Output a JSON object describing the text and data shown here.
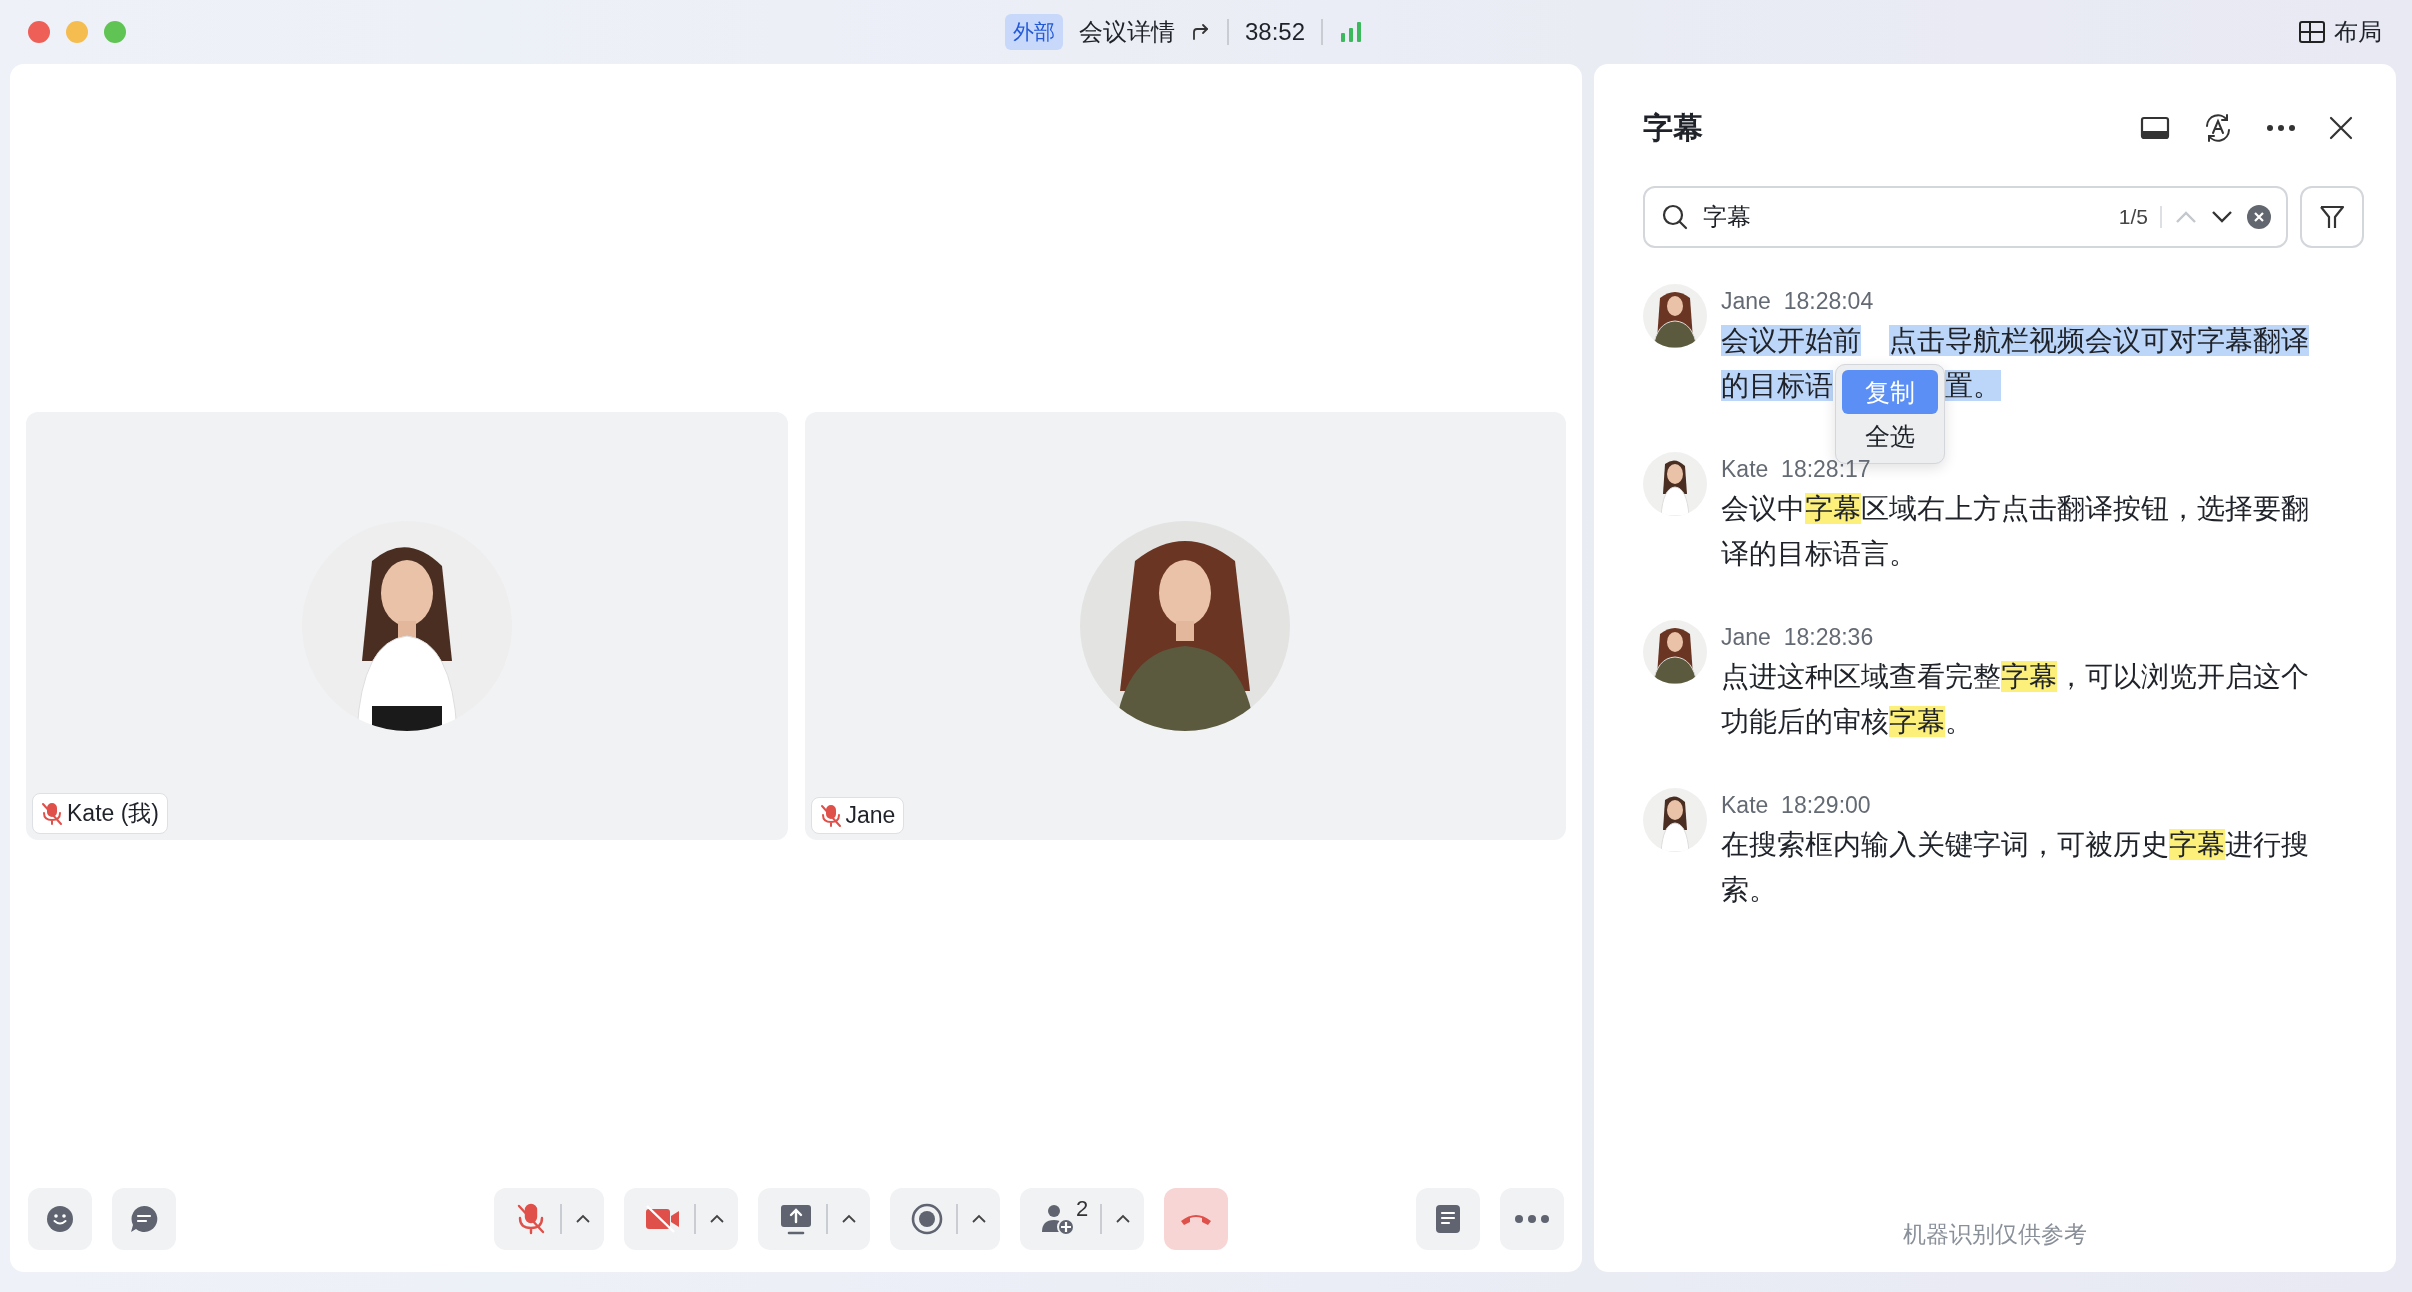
{
  "title_bar": {
    "tag": "外部",
    "title": "会议详情",
    "timer": "38:52",
    "layout_label": "布局"
  },
  "tiles": [
    {
      "name": "Kate (我)",
      "muted": true,
      "kind": "picture"
    },
    {
      "name": "Jane",
      "muted": true,
      "kind": "picture"
    }
  ],
  "toolbar": {
    "left": [
      {
        "kind": "emoji"
      },
      {
        "kind": "chat"
      }
    ],
    "center": [
      {
        "kind": "mic",
        "off": true
      },
      {
        "kind": "camera",
        "off": true
      },
      {
        "kind": "share",
        "off": false
      },
      {
        "kind": "record",
        "off": false
      },
      {
        "kind": "participants",
        "off": false,
        "count": "2"
      }
    ],
    "end_call": {
      "kind": "hangup"
    },
    "right": [
      {
        "kind": "notes"
      },
      {
        "kind": "more"
      }
    ]
  },
  "captions": {
    "title": "字幕",
    "search": {
      "value": "字幕",
      "counter": "1/5",
      "prev_disabled": true,
      "next_disabled": false
    },
    "entries": [
      {
        "speaker": "Jane",
        "time": "18:28:04",
        "selected": true,
        "segments": [
          {
            "text": "会议开始前",
            "match": false,
            "covered": false
          },
          {
            "text": "点击导航栏视频会议可对字幕翻译",
            "match": false,
            "covered": true
          },
          {
            "text": "的目标语",
            "match": false,
            "covered": false
          },
          {
            "text": "置。",
            "match": false,
            "covered": true
          }
        ]
      },
      {
        "speaker": "Kate",
        "time": "18:28:17",
        "selected": false,
        "segments": [
          {
            "text": "会议中",
            "match": false
          },
          {
            "text": "字幕",
            "match": true
          },
          {
            "text": "区域右上方点击翻译按钮，选择要翻译的目标语言。",
            "match": false
          }
        ]
      },
      {
        "speaker": "Jane",
        "time": "18:28:36",
        "selected": false,
        "segments": [
          {
            "text": "点进这种区域查看完整",
            "match": false
          },
          {
            "text": "字幕",
            "match": true
          },
          {
            "text": "，可以浏览开启这个功能后的审核",
            "match": false
          },
          {
            "text": "字幕",
            "match": true
          },
          {
            "text": "。",
            "match": false
          }
        ]
      },
      {
        "speaker": "Kate",
        "time": "18:29:00",
        "selected": false,
        "segments": [
          {
            "text": "在搜索框内输入关键字词，可被历史",
            "match": false
          },
          {
            "text": "字幕",
            "match": true
          },
          {
            "text": "进行搜索。",
            "match": false
          }
        ]
      }
    ],
    "context_menu": [
      {
        "label": "复制",
        "selected": true
      },
      {
        "label": "全选",
        "selected": false
      }
    ],
    "footer": "机器识别仅供参考"
  }
}
